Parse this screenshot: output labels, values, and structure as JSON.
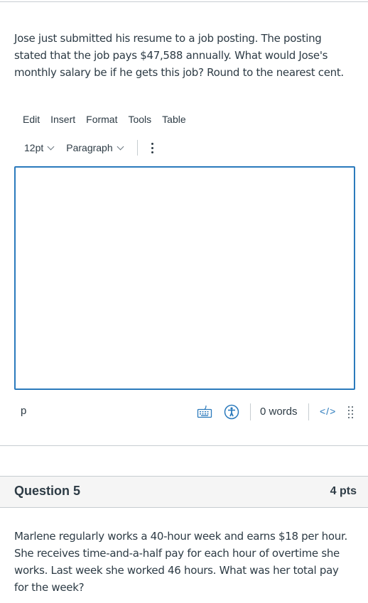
{
  "question4": {
    "text": "Jose just submitted his resume to a job posting.  The posting stated that the job pays $47,588 annually.  What would Jose's monthly salary be if he gets this job?  Round to the nearest cent."
  },
  "editor": {
    "menu": [
      "Edit",
      "Insert",
      "Format",
      "Tools",
      "Table"
    ],
    "font_size": "12pt",
    "block_format": "Paragraph",
    "content": "",
    "status": {
      "path": "p",
      "word_count": "0 words",
      "code_view_label": "</>"
    },
    "accent_color": "#2b7abc"
  },
  "question5": {
    "title": "Question 5",
    "points": "4 pts",
    "text": "Marlene regularly works a 40-hour week and earns $18 per hour.  She receives time-and-a-half pay for each hour of overtime she works.  Last week she worked 46 hours. What was her total pay for the week?"
  }
}
